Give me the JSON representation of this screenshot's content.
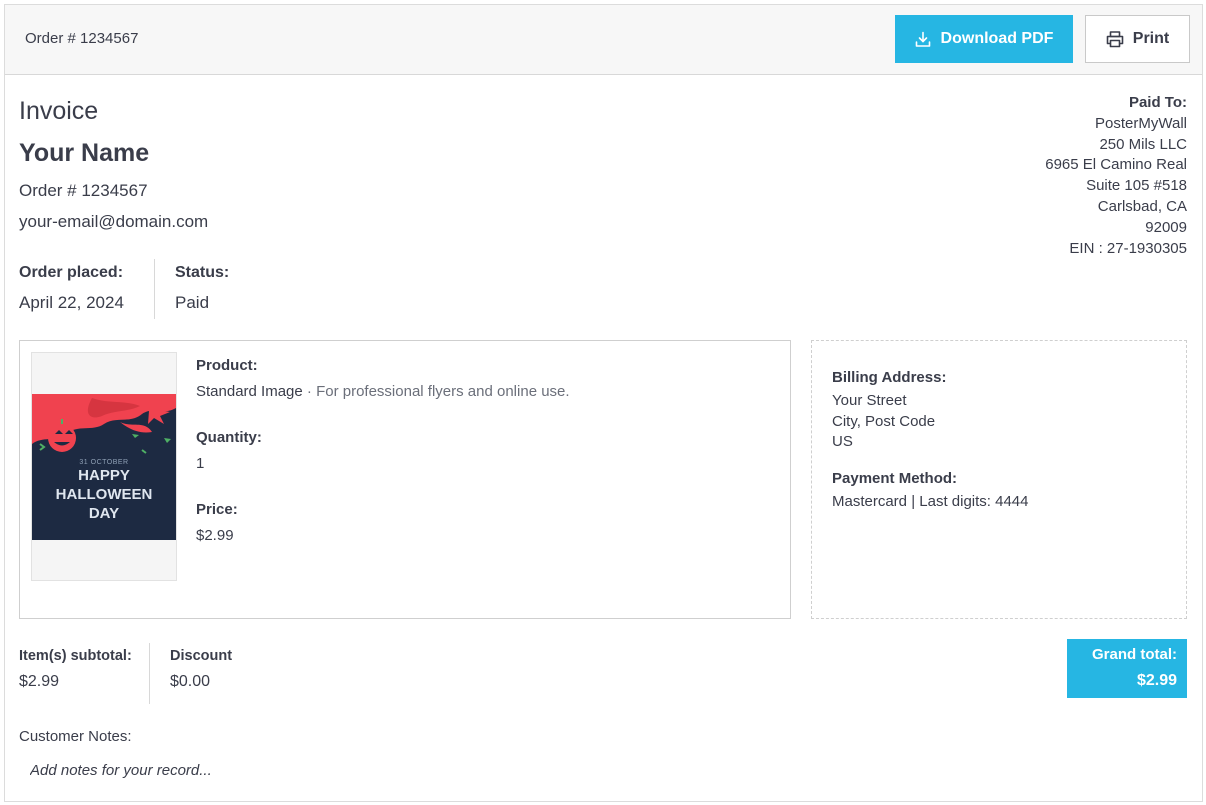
{
  "header": {
    "order_ref": "Order # 1234567",
    "download_label": "Download PDF",
    "print_label": "Print",
    "accent_color": "#26b6e3"
  },
  "invoice": {
    "title": "Invoice",
    "customer_name": "Your Name",
    "order_number": "Order # 1234567",
    "email": "your-email@domain.com"
  },
  "meta": {
    "order_placed_label": "Order placed:",
    "order_placed_value": "April 22, 2024",
    "status_label": "Status:",
    "status_value": "Paid"
  },
  "paid_to": {
    "label": "Paid To:",
    "lines": [
      "PosterMyWall",
      "250 Mils LLC",
      "6965 El Camino Real",
      "Suite 105 #518",
      "Carlsbad, CA",
      "92009",
      "EIN : 27-1930305"
    ]
  },
  "product": {
    "thumbnail": {
      "small_text": "31 OCTOBER",
      "line1": "HAPPY",
      "line2": "HALLOWEEN",
      "line3": "DAY"
    },
    "product_label": "Product:",
    "product_name": "Standard Image",
    "product_desc": " · For professional flyers and online use.",
    "quantity_label": "Quantity:",
    "quantity_value": "1",
    "price_label": "Price:",
    "price_value": "$2.99"
  },
  "billing": {
    "address_label": "Billing Address:",
    "address_lines": [
      "Your Street",
      "City, Post Code",
      "US"
    ],
    "payment_label": "Payment Method:",
    "payment_value": "Mastercard | Last digits: 4444"
  },
  "summary": {
    "subtotal_label": "Item(s) subtotal:",
    "subtotal_value": "$2.99",
    "discount_label": "Discount",
    "discount_value": "$0.00",
    "grand_total_label": "Grand total:",
    "grand_total_value": "$2.99"
  },
  "notes": {
    "label": "Customer Notes:",
    "placeholder": "Add notes for your record..."
  },
  "icons": {
    "download": "download-icon",
    "print": "printer-icon"
  }
}
